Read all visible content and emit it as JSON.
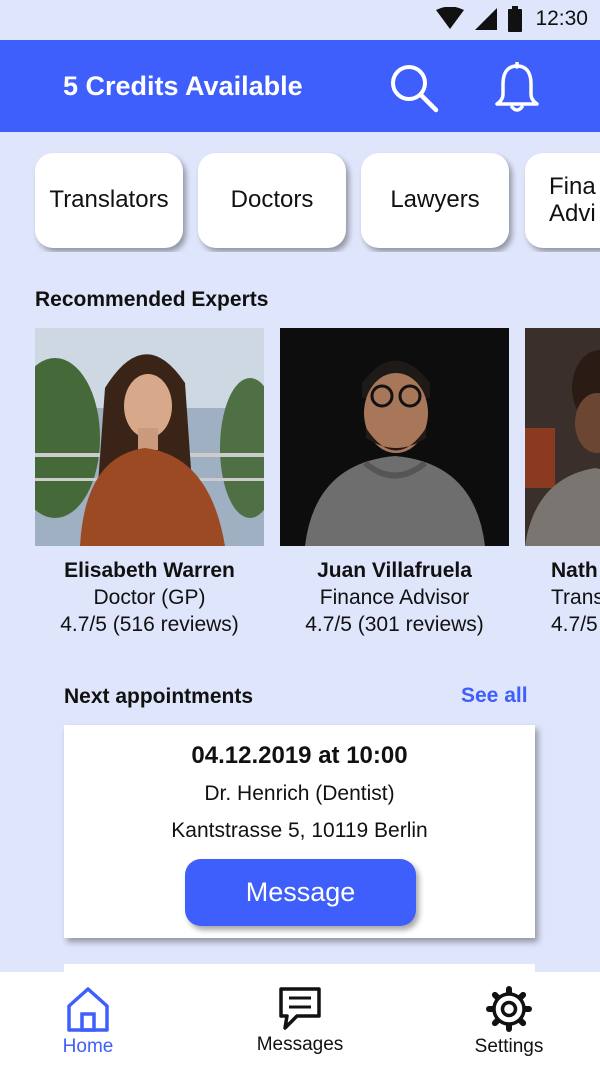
{
  "status_bar": {
    "time": "12:30",
    "icons": [
      "wifi-icon",
      "signal-icon",
      "battery-icon"
    ]
  },
  "header": {
    "credits": "5 Credits Available",
    "icons": [
      "search-icon",
      "bell-icon"
    ]
  },
  "categories": [
    "Translators",
    "Doctors",
    "Lawyers",
    "Fina\nAdvi"
  ],
  "recommended_title": "Recommended Experts",
  "experts": [
    {
      "name": "Elisabeth Warren",
      "role": "Doctor (GP)",
      "rating": "4.7/5 (516 reviews)"
    },
    {
      "name": "Juan Villafruela",
      "role": "Finance Advisor",
      "rating": "4.7/5 (301 reviews)"
    },
    {
      "name": "Nath",
      "role": "Trans",
      "rating": "4.7/5"
    }
  ],
  "appointments": {
    "title": "Next appointments",
    "see_all": "See all",
    "items": [
      {
        "date": "04.12.2019 at 10:00",
        "doctor": "Dr. Henrich (Dentist)",
        "address": "Kantstrasse 5, 10119 Berlin",
        "button": "Message"
      }
    ]
  },
  "nav": [
    {
      "label": "Home",
      "icon": "home-icon",
      "active": true
    },
    {
      "label": "Messages",
      "icon": "message-icon",
      "active": false
    },
    {
      "label": "Settings",
      "icon": "gear-icon",
      "active": false
    }
  ],
  "colors": {
    "accent": "#3e5ffb",
    "background": "#dfe5fb"
  }
}
